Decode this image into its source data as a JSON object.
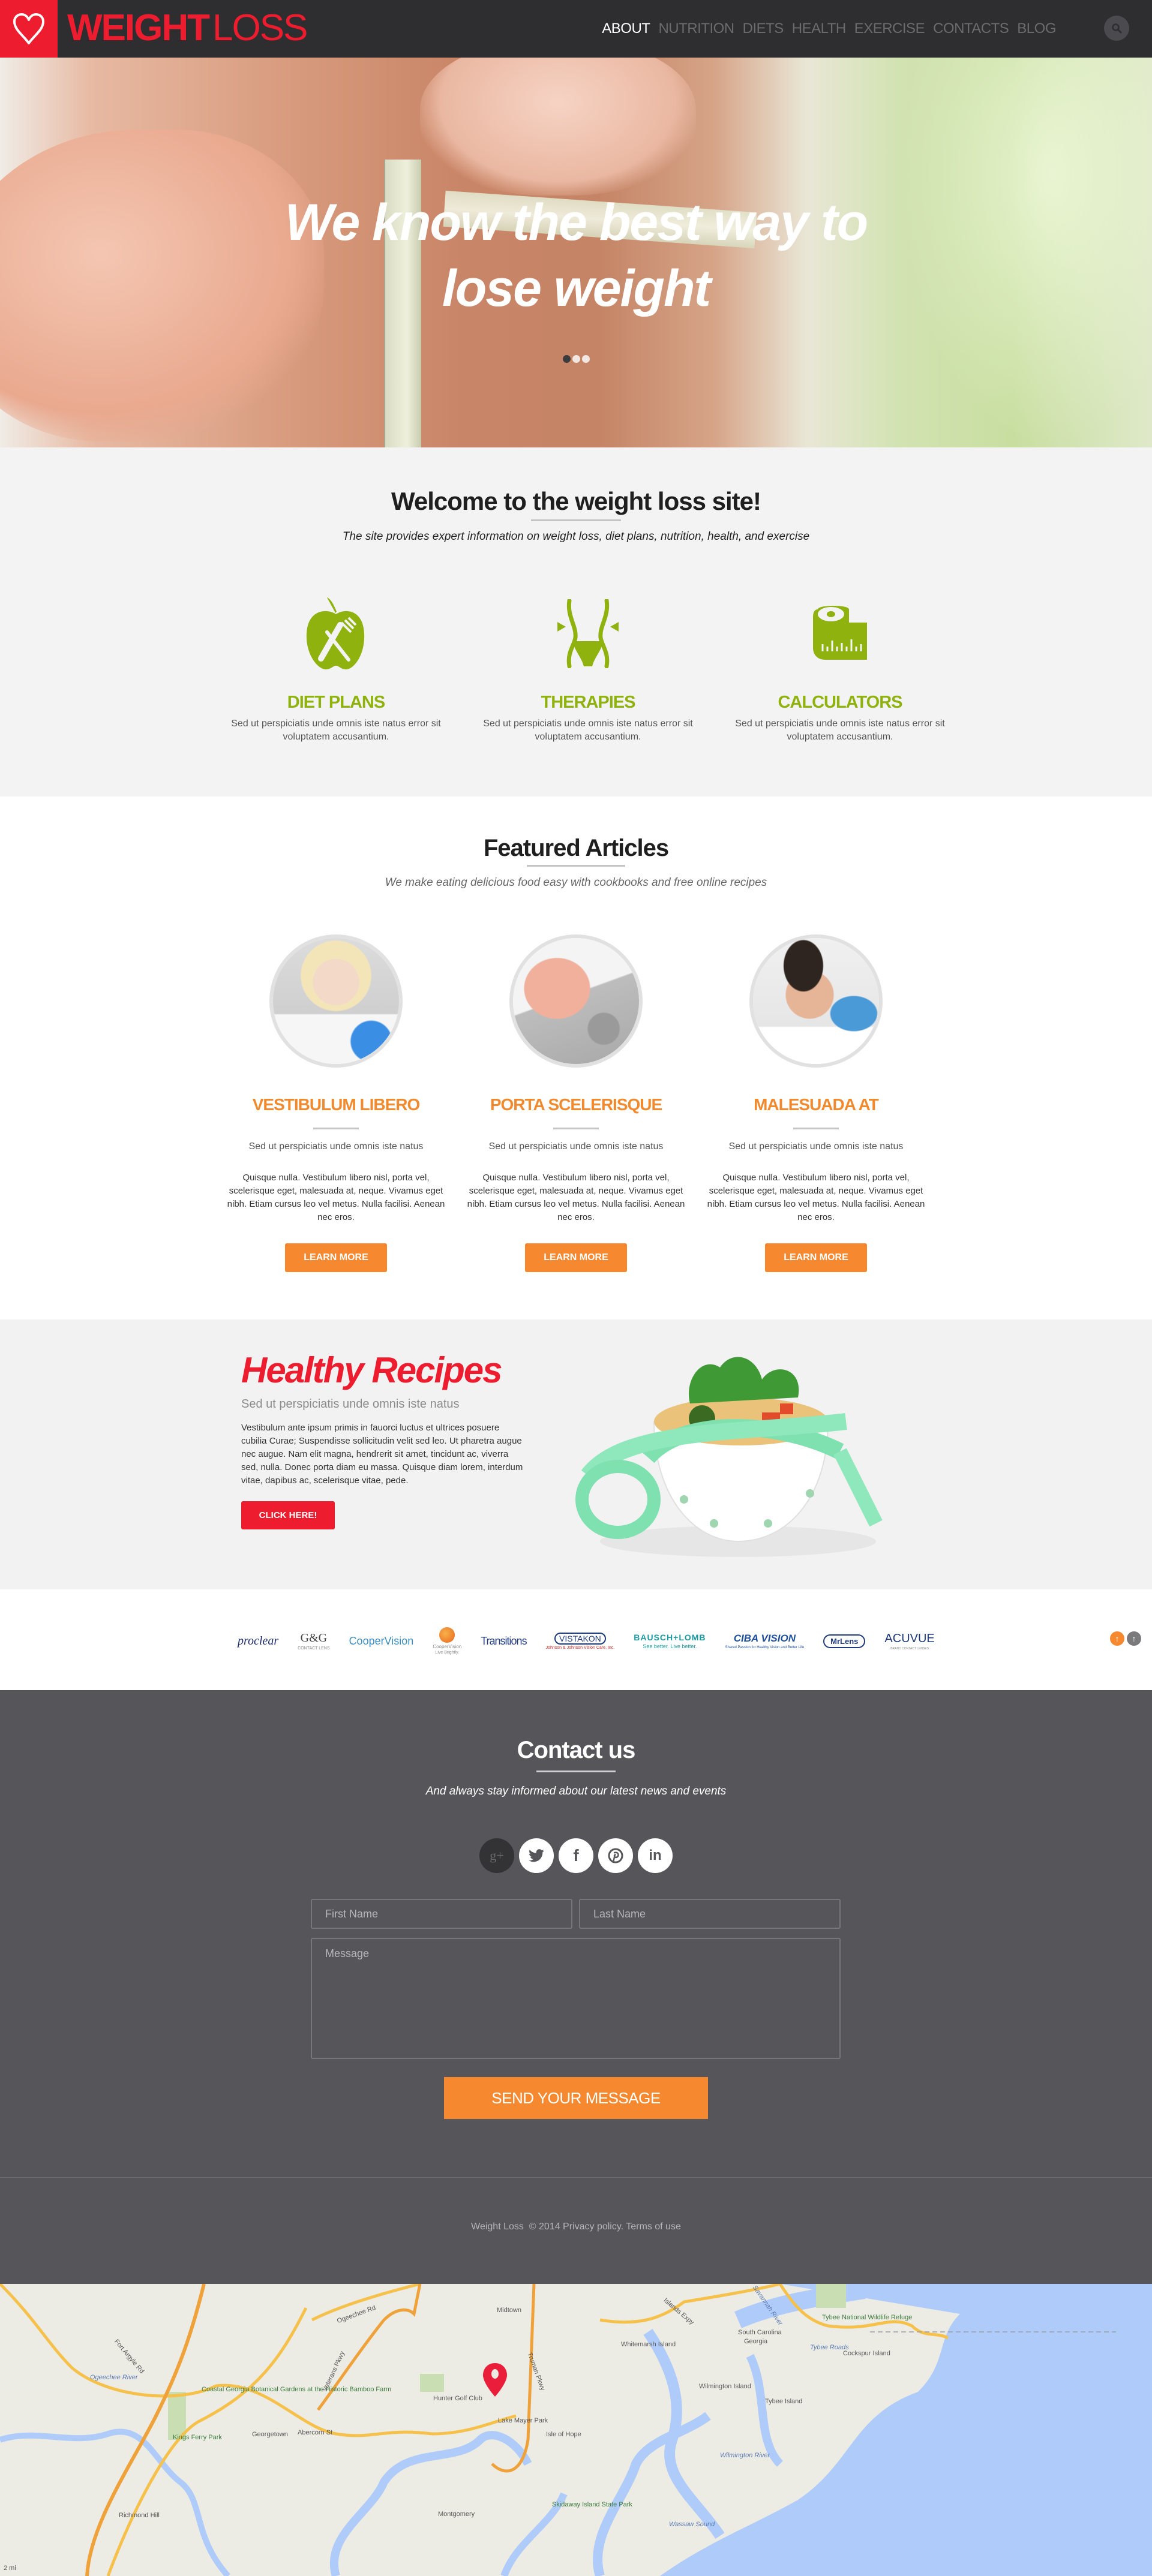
{
  "header": {
    "logo_bold": "WEIGHT",
    "logo_light": "LOSS",
    "logo_icon": "heart-outline-icon",
    "nav": [
      {
        "label": "ABOUT",
        "active": true
      },
      {
        "label": "NUTRITION",
        "active": false
      },
      {
        "label": "DIETS",
        "active": false
      },
      {
        "label": "HEALTH",
        "active": false
      },
      {
        "label": "EXERCISE",
        "active": false
      },
      {
        "label": "CONTACTS",
        "active": false
      },
      {
        "label": "BLOG",
        "active": false
      }
    ],
    "search_icon": "search-icon"
  },
  "hero": {
    "title_line1": "We know the best way to",
    "title_line2": "lose weight",
    "slides_total": 3,
    "active_slide": 1
  },
  "welcome": {
    "title": "Welcome to the weight loss site!",
    "subtitle": "The site provides expert information on weight loss, diet plans, nutrition, health, and exercise",
    "features": [
      {
        "icon": "apple-fork-knife-icon",
        "title": "DIET PLANS",
        "text": "Sed ut perspiciatis unde omnis iste natus error sit voluptatem accusantium."
      },
      {
        "icon": "waist-icon",
        "title": "THERAPIES",
        "text": "Sed ut perspiciatis unde omnis iste natus error sit voluptatem accusantium."
      },
      {
        "icon": "measuring-tape-icon",
        "title": "CALCULATORS",
        "text": "Sed ut perspiciatis unde omnis iste natus error sit voluptatem accusantium."
      }
    ]
  },
  "articles": {
    "title": "Featured Articles",
    "subtitle": "We make eating delicious food easy with cookbooks and free online recipes",
    "cards": [
      {
        "image": "smiling-woman-photo",
        "title": "VESTIBULUM LIBERO",
        "lead": "Sed ut perspiciatis unde omnis iste natus",
        "body": "Quisque nulla. Vestibulum libero nisl, porta vel, scelerisque eget, malesuada at, neque. Vivamus eget nibh. Etiam cursus leo vel metus. Nulla facilisi. Aenean nec eros.",
        "button": "LEARN MORE"
      },
      {
        "image": "foot-on-scale-photo",
        "title": "PORTA SCELERISQUE",
        "lead": "Sed ut perspiciatis unde omnis iste natus",
        "body": "Quisque nulla. Vestibulum libero nisl, porta vel, scelerisque eget, malesuada at, neque. Vivamus eget nibh. Etiam cursus leo vel metus. Nulla facilisi. Aenean nec eros.",
        "button": "LEARN MORE"
      },
      {
        "image": "smiling-man-exercise-photo",
        "title": "MALESUADA AT",
        "lead": "Sed ut perspiciatis unde omnis iste natus",
        "body": "Quisque nulla. Vestibulum libero nisl, porta vel, scelerisque eget, malesuada at, neque. Vivamus eget nibh. Etiam cursus leo vel metus. Nulla facilisi. Aenean nec eros.",
        "button": "LEARN MORE"
      }
    ]
  },
  "recipes": {
    "title": "Healthy Recipes",
    "subtitle": "Sed ut perspiciatis unde omnis iste natus",
    "body": "Vestibulum ante ipsum primis in fauorci luctus et ultrices posuere cubilia Curae; Suspendisse sollicitudin velit sed leo. Ut pharetra augue nec augue. Nam elit magna, hendrerit sit amet, tincidunt ac, viverra sed, nulla. Donec porta diam eu massa. Quisque diam lorem, interdum vitae, dapibus ac, scelerisque vitae, pede.",
    "button": "CLICK HERE!",
    "image": "soup-bowl-measuring-tape-photo"
  },
  "brands": {
    "items": [
      {
        "name": "proclear",
        "sub": ""
      },
      {
        "name": "G&G",
        "sub": "CONTACT LENS"
      },
      {
        "name": "CooperVision",
        "sub": ""
      },
      {
        "name": "CooperVision",
        "sub": "Live Brightly."
      },
      {
        "name": "Transitions",
        "sub": ""
      },
      {
        "name": "VISTAKON",
        "sub": "Johnson & Johnson Vision Care, Inc."
      },
      {
        "name": "BAUSCH+LOMB",
        "sub": "See better. Live better."
      },
      {
        "name": "CIBA VISION",
        "sub": "Shared Passion for Healthy Vision and Better Life"
      },
      {
        "name": "MrLens",
        "sub": ""
      },
      {
        "name": "ACUVUE",
        "sub": "BRAND CONTACT LENSES"
      }
    ],
    "scroll_prev": "arrow-up-icon",
    "scroll_top": "arrow-up-icon"
  },
  "contact": {
    "title": "Contact us",
    "subtitle": "And always stay informed about our latest news and events",
    "socials": [
      {
        "name": "google-plus",
        "glyph": "g+"
      },
      {
        "name": "twitter",
        "glyph": "t"
      },
      {
        "name": "facebook",
        "glyph": "f"
      },
      {
        "name": "pinterest",
        "glyph": "p"
      },
      {
        "name": "linkedin",
        "glyph": "in"
      }
    ],
    "first_name_placeholder": "First Name",
    "last_name_placeholder": "Last Name",
    "message_placeholder": "Message",
    "first_name_value": "",
    "last_name_value": "",
    "message_value": "",
    "send_button": "SEND YOUR MESSAGE"
  },
  "footer": {
    "brand": "Weight Loss",
    "copyright": "© 2014",
    "privacy": "Privacy policy.",
    "terms": "Terms of use"
  },
  "map": {
    "labels": [
      "Coastal Georgia Botanical Gardens at the Historic Bamboo Farm",
      "Kings Ferry Park",
      "Ogeechee River",
      "Georgetown",
      "Hunter Golf Club",
      "Lake Mayer Park",
      "Midtown",
      "Richmond Hill",
      "Montgomery",
      "Whitemarsh Island",
      "Wilmington Island",
      "Wilmington River",
      "Tybee National Wildlife Refuge",
      "Cockspur Island",
      "Tybee Island",
      "Tybee Roads",
      "Wassaw Sound",
      "South Carolina",
      "Georgia",
      "Isle of Hope",
      "Skidaway Island State Park",
      "Abercorn St",
      "Veterans Pkwy",
      "Truman Pkwy",
      "Savannah River",
      "Islands Expy",
      "Ogeechee Rd",
      "Fort Argyle Rd"
    ],
    "scale": "2 mi",
    "marker": "location-pin-icon"
  }
}
